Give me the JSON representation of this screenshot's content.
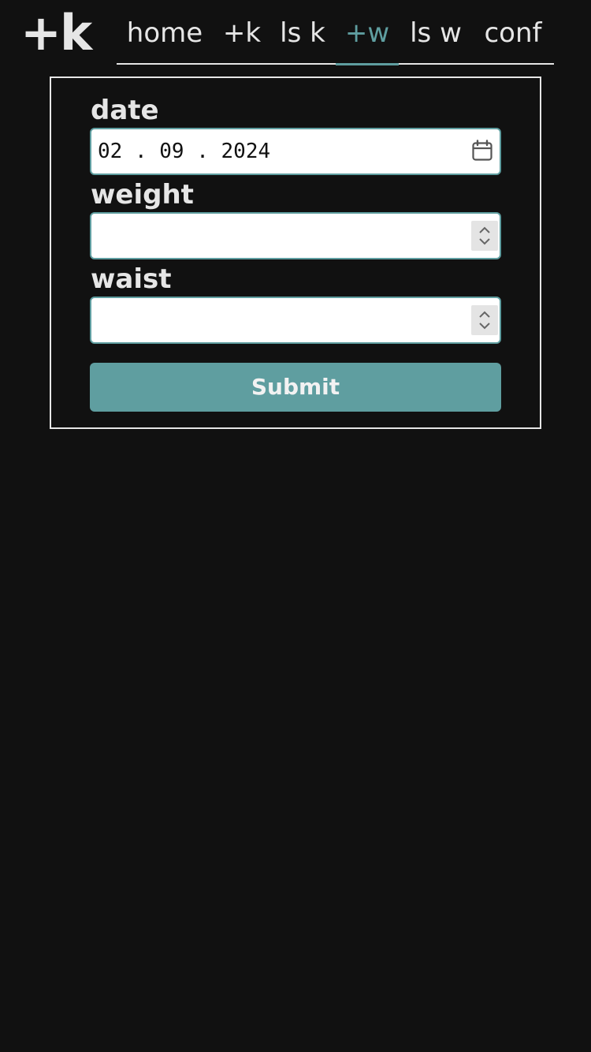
{
  "logo": {
    "text": "+k"
  },
  "nav": {
    "items": [
      {
        "label": "home",
        "active": false
      },
      {
        "label": "+k",
        "active": false
      },
      {
        "label": "ls k",
        "active": false
      },
      {
        "label": "+w",
        "active": true
      },
      {
        "label": "ls w",
        "active": false
      },
      {
        "label": "conf",
        "active": false
      }
    ]
  },
  "form": {
    "date": {
      "label": "date",
      "value": "02 . 09 . 2024"
    },
    "weight": {
      "label": "weight",
      "value": ""
    },
    "waist": {
      "label": "waist",
      "value": ""
    },
    "submit_label": "Submit"
  },
  "colors": {
    "background": "#111111",
    "foreground": "#e6e6e6",
    "accent": "#5f9ea0"
  },
  "icons": {
    "date": "calendar-icon",
    "number": "spinner-icon"
  }
}
